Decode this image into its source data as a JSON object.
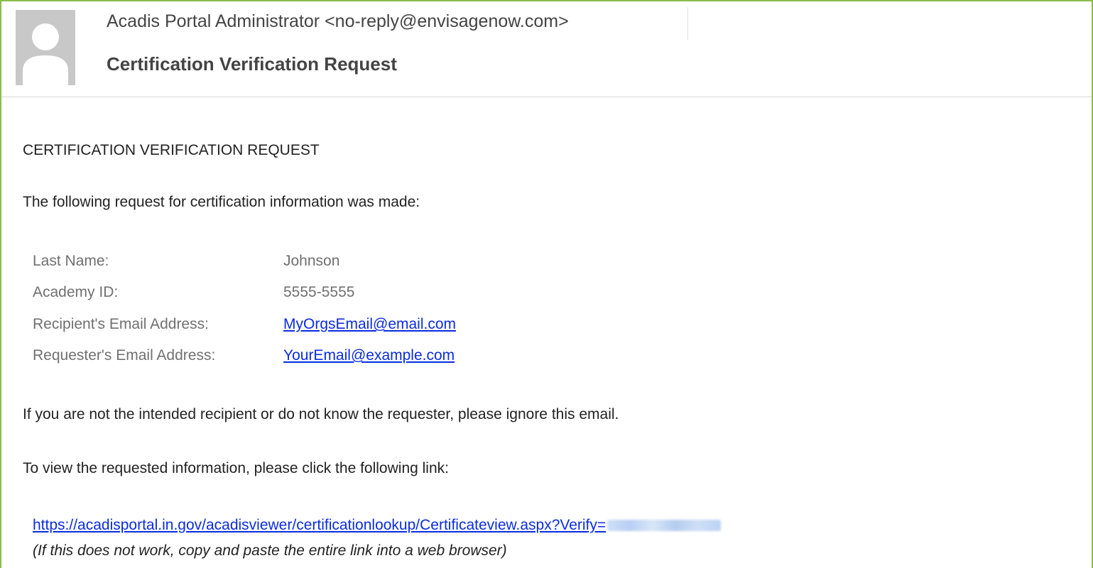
{
  "email": {
    "sender": "Acadis Portal Administrator <no-reply@envisagenow.com>",
    "subject": "Certification Verification Request",
    "heading": "CERTIFICATION VERIFICATION REQUEST",
    "intro": "The following request for certification information was made:",
    "fields": [
      {
        "label": "Last Name:",
        "value": "Johnson"
      },
      {
        "label": "Academy ID:",
        "value": "5555-5555"
      },
      {
        "label": "Recipient's Email Address:",
        "value": "MyOrgsEmail@email.com"
      },
      {
        "label": "Requester's Email Address:",
        "value": "YourEmail@example.com"
      }
    ],
    "ignore_notice": "If you are not the intended recipient or do not know the requester, please ignore this email.",
    "view_instruction": "To view the requested information, please click the following link:",
    "link_url": "https://acadisportal.in.gov/acadisviewer/certificationlookup/Certificateview.aspx?Verify=",
    "link_note": "(If this does not work, copy and paste the entire link into a web browser)"
  },
  "colors": {
    "frame_border": "#8bbd4a",
    "link": "#0b2ce0",
    "label_gray": "#707070"
  },
  "icons": {
    "avatar": "default-person-icon"
  }
}
